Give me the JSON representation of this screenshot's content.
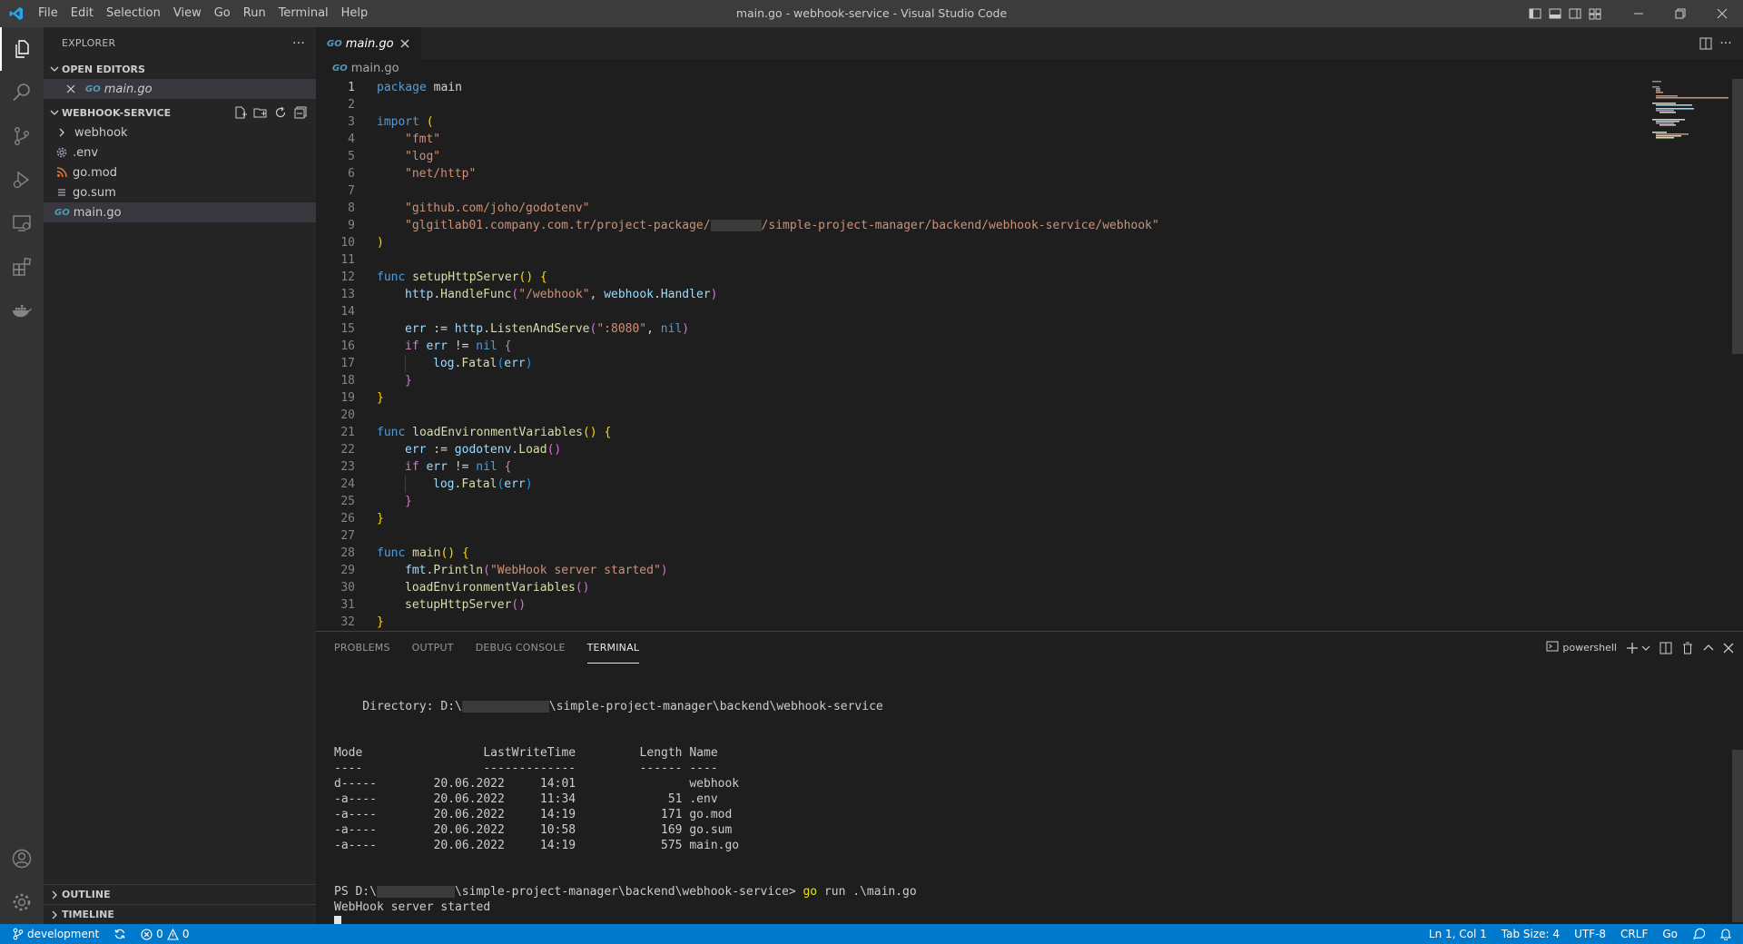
{
  "window": {
    "menu": [
      "File",
      "Edit",
      "Selection",
      "View",
      "Go",
      "Run",
      "Terminal",
      "Help"
    ],
    "title": "main.go - webhook-service - Visual Studio Code"
  },
  "sidebar": {
    "header": "EXPLORER",
    "open_editors_title": "OPEN EDITORS",
    "open_editors": [
      {
        "label": "main.go",
        "icon": "go-file-icon"
      }
    ],
    "folder_title": "WEBHOOK-SERVICE",
    "tree": [
      {
        "label": "webhook",
        "type": "folder",
        "icon": "chevron-right-icon"
      },
      {
        "label": ".env",
        "type": "file",
        "icon": "gear-icon"
      },
      {
        "label": "go.mod",
        "type": "file",
        "icon": "rss-icon"
      },
      {
        "label": "go.sum",
        "type": "file",
        "icon": "lines-icon"
      },
      {
        "label": "main.go",
        "type": "file",
        "icon": "go-file-icon",
        "selected": true
      }
    ],
    "outline": "OUTLINE",
    "timeline": "TIMELINE"
  },
  "editor": {
    "tab_label": "main.go",
    "go_glyph": "GO",
    "breadcrumb": "main.go",
    "line_numbers": [
      "1",
      "2",
      "3",
      "4",
      "5",
      "6",
      "7",
      "8",
      "9",
      "10",
      "11",
      "12",
      "13",
      "14",
      "15",
      "16",
      "17",
      "18",
      "19",
      "20",
      "21",
      "22",
      "23",
      "24",
      "25",
      "26",
      "27",
      "28",
      "29",
      "30",
      "31",
      "32"
    ],
    "code": {
      "l1a": "package",
      "l1b": " main",
      "l3a": "import",
      "l3b": " (",
      "l4": "\"fmt\"",
      "l5": "\"log\"",
      "l6": "\"net/http\"",
      "l8": "\"github.com/joho/godotenv\"",
      "l9a": "\"glgitlab01.company.com.tr/project-package/",
      "l9b": "/simple-project-manager/backend/webhook-service/webhook\"",
      "l10": ")",
      "func": "func",
      "l12fn": "setupHttpServer",
      "l13a": "http",
      "l13b": "HandleFunc",
      "l13c": "\"/webhook\"",
      "l13d": "webhook",
      "l13e": "Handler",
      "err": "err",
      "l15a": "http",
      "l15b": "ListenAndServe",
      "l15c": "\":8080\"",
      "nil": "nil",
      "if": "if",
      "neq": " != ",
      "assign": " := ",
      "log": "log",
      "fatal": "Fatal",
      "l21fn": "loadEnvironmentVariables",
      "l22a": "godotenv",
      "l22b": "Load",
      "l28fn": "main",
      "l29a": "fmt",
      "l29b": "Println",
      "l29c": "\"WebHook server started\"",
      "l30": "loadEnvironmentVariables",
      "l31": "setupHttpServer"
    }
  },
  "panel": {
    "tabs": [
      "PROBLEMS",
      "OUTPUT",
      "DEBUG CONSOLE",
      "TERMINAL"
    ],
    "active_tab": "TERMINAL",
    "shell": "powershell",
    "terminal": {
      "dir_prefix": "    Directory: D:\\",
      "dir_suffix": "\\simple-project-manager\\backend\\webhook-service",
      "header": "Mode                 LastWriteTime         Length Name",
      "underline": "----                 -------------         ------ ----",
      "rows": [
        "d-----        20.06.2022     14:01                webhook",
        "-a----        20.06.2022     11:34             51 .env",
        "-a----        20.06.2022     14:19            171 go.mod",
        "-a----        20.06.2022     10:58            169 go.sum",
        "-a----        20.06.2022     14:19            575 main.go"
      ],
      "prompt_prefix": "PS D:\\",
      "prompt_suffix": "\\simple-project-manager\\backend\\webhook-service> ",
      "command_go": "go",
      "command_rest": " run .\\main.go",
      "output": "WebHook server started"
    }
  },
  "statusbar": {
    "branch": "development",
    "errors": "0",
    "warnings": "0",
    "position": "Ln 1, Col 1",
    "tab_size": "Tab Size: 4",
    "encoding": "UTF-8",
    "eol": "CRLF",
    "language": "Go"
  },
  "colors": {
    "accent": "#007acc",
    "titlebar": "#3c3c3c",
    "sidebar": "#252526",
    "editor": "#1e1e1e"
  }
}
